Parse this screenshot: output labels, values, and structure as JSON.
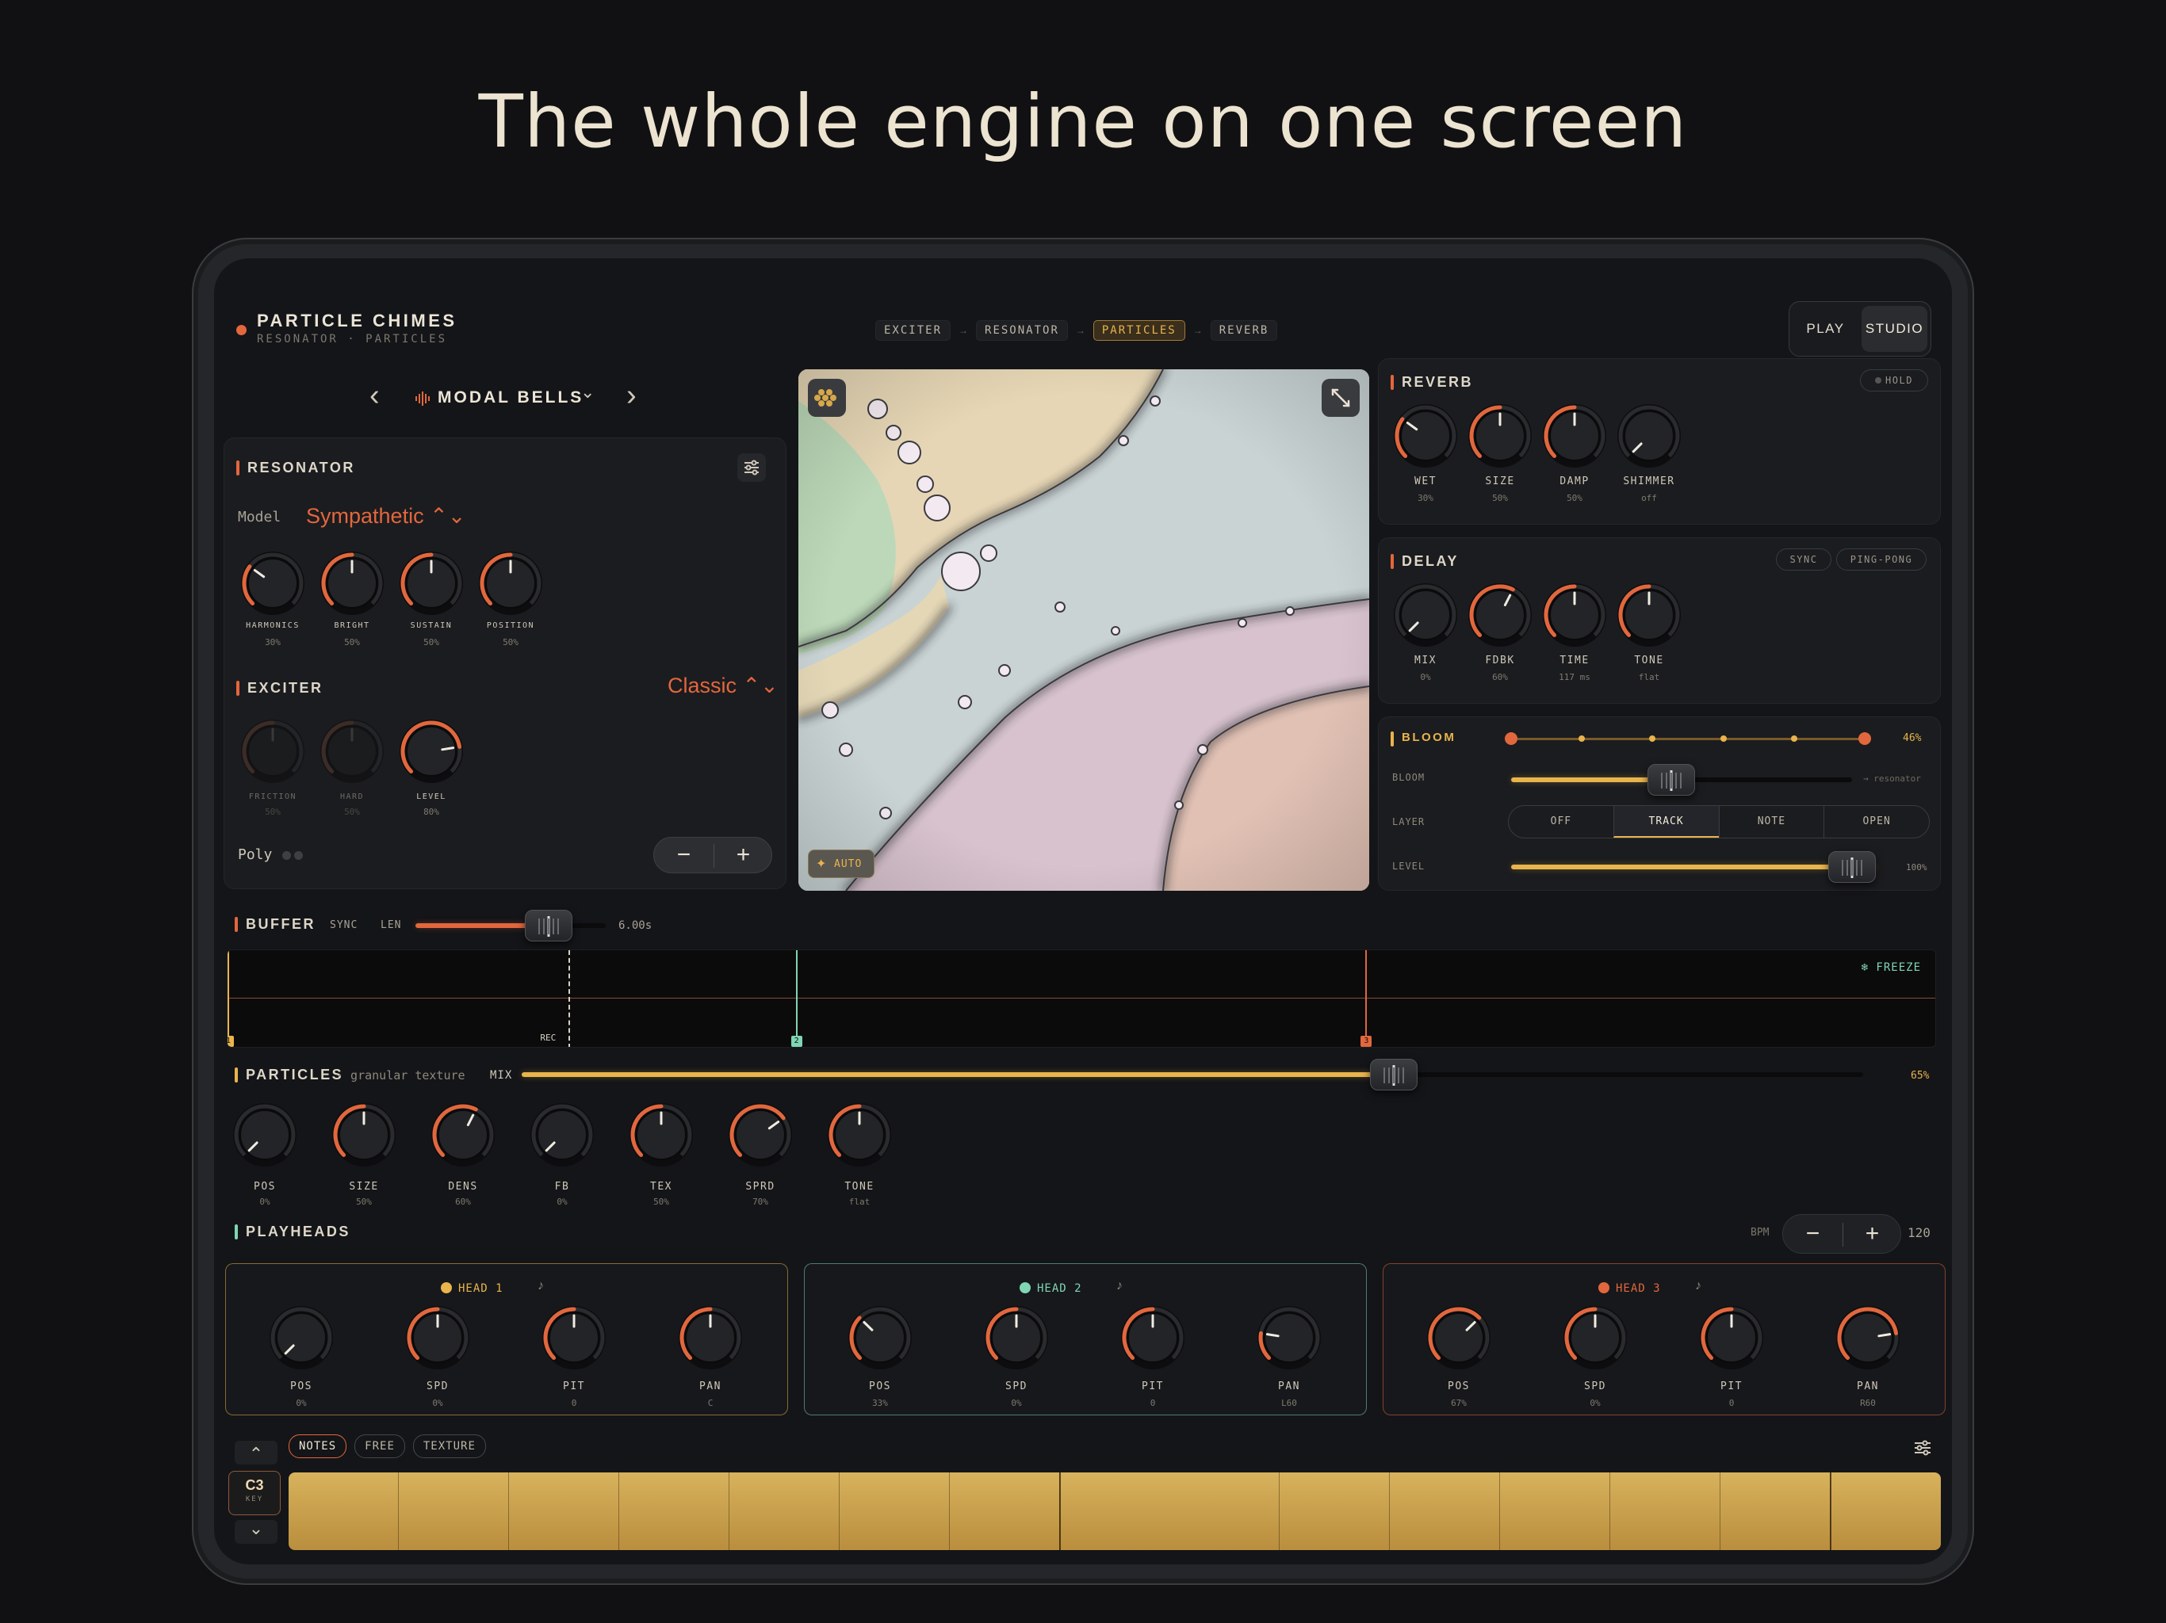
{
  "headline": "The whole engine on one screen",
  "app": {
    "title": "PARTICLE CHIMES",
    "subtitle": "RESONATOR · PARTICLES",
    "status_color": "#e2673d"
  },
  "signal_chain": {
    "items": [
      "EXCITER",
      "RESONATOR",
      "PARTICLES",
      "REVERB"
    ],
    "arrow": "→",
    "active": "PARTICLES"
  },
  "mode_switch": {
    "options": [
      "PLAY",
      "STUDIO"
    ],
    "active": "STUDIO"
  },
  "preset": {
    "name": "MODAL BELLS",
    "prev": "‹",
    "next": "›",
    "caret": "⌄"
  },
  "resonator": {
    "title": "RESONATOR",
    "model_label": "Model",
    "model_value": "Sympathetic ⌃⌄",
    "knobs": [
      {
        "label": "HARMONICS",
        "value": "30%",
        "level": 0.3
      },
      {
        "label": "BRIGHT",
        "value": "50%",
        "level": 0.5
      },
      {
        "label": "SUSTAIN",
        "value": "50%",
        "level": 0.5
      },
      {
        "label": "POSITION",
        "value": "50%",
        "level": 0.5
      }
    ]
  },
  "exciter": {
    "title": "EXCITER",
    "type_value": "Classic ⌃⌄",
    "knobs": [
      {
        "label": "FRICTION",
        "value": "50%",
        "level": 0.5,
        "dim": true
      },
      {
        "label": "HARD",
        "value": "50%",
        "level": 0.5,
        "dim": true
      },
      {
        "label": "LEVEL",
        "value": "80%",
        "level": 0.8,
        "dim": false
      }
    ],
    "poly_label": "Poly",
    "minus": "−",
    "plus": "+"
  },
  "visualizer": {
    "auto_label": "AUTO"
  },
  "reverb": {
    "title": "REVERB",
    "hold_label": "HOLD",
    "knobs": [
      {
        "label": "WET",
        "value": "30%",
        "level": 0.3
      },
      {
        "label": "SIZE",
        "value": "50%",
        "level": 0.5
      },
      {
        "label": "DAMP",
        "value": "50%",
        "level": 0.5
      },
      {
        "label": "SHIMMER",
        "value": "off",
        "level": 0.0
      }
    ]
  },
  "delay": {
    "title": "DELAY",
    "sync_label": "SYNC",
    "pingpong_label": "PING-PONG",
    "knobs": [
      {
        "label": "MIX",
        "value": "0%",
        "level": 0.0
      },
      {
        "label": "FDBK",
        "value": "60%",
        "level": 0.6
      },
      {
        "label": "TIME",
        "value": "117 ms",
        "level": 0.5
      },
      {
        "label": "TONE",
        "value": "flat",
        "level": 0.5
      }
    ]
  },
  "bloom": {
    "title": "BLOOM",
    "amount": "46%",
    "amount_level": 0.46,
    "bloom_label": "BLOOM",
    "bloom_level": 0.47,
    "bloom_target": "→ resonator",
    "layer_label": "LAYER",
    "layer_options": [
      "OFF",
      "TRACK",
      "NOTE",
      "OPEN"
    ],
    "layer_active": "TRACK",
    "level_label": "LEVEL",
    "level_value": "100%",
    "level_level": 1.0
  },
  "buffer": {
    "title": "BUFFER",
    "sync_label": "SYNC",
    "len_label": "LEN",
    "len_value": "6.00s",
    "len_level": 0.7,
    "freeze_label": "❄ FREEZE",
    "rec_label": "REC",
    "markers": [
      {
        "label": "1",
        "pos": 0.0,
        "color": "#e9b44c"
      },
      {
        "label": "2",
        "pos": 0.333,
        "color": "#7fd6b4"
      },
      {
        "label": "3",
        "pos": 0.667,
        "color": "#e2673d"
      }
    ],
    "rec_pos": 0.2
  },
  "particles": {
    "title": "PARTICLES",
    "subtitle": "· granular texture",
    "mix_label": "MIX",
    "mix_value": "65%",
    "mix_level": 0.65,
    "knobs": [
      {
        "label": "POS",
        "value": "0%",
        "level": 0.0
      },
      {
        "label": "SIZE",
        "value": "50%",
        "level": 0.5
      },
      {
        "label": "DENS",
        "value": "60%",
        "level": 0.6
      },
      {
        "label": "FB",
        "value": "0%",
        "level": 0.0
      },
      {
        "label": "TEX",
        "value": "50%",
        "level": 0.5
      },
      {
        "label": "SPRD",
        "value": "70%",
        "level": 0.7
      },
      {
        "label": "TONE",
        "value": "flat",
        "level": 0.5
      }
    ]
  },
  "playheads": {
    "title": "PLAYHEADS",
    "bpm_label": "BPM",
    "bpm_value": "120",
    "minus": "−",
    "plus": "+",
    "note_icon": "♪",
    "heads": [
      {
        "name": "HEAD 1",
        "color": "#e9b44c",
        "knobs": [
          {
            "label": "POS",
            "value": "0%",
            "level": 0.0
          },
          {
            "label": "SPD",
            "value": "0%",
            "level": 0.5
          },
          {
            "label": "PIT",
            "value": "0",
            "level": 0.5
          },
          {
            "label": "PAN",
            "value": "C",
            "level": 0.5
          }
        ]
      },
      {
        "name": "HEAD 2",
        "color": "#7fd6b4",
        "knobs": [
          {
            "label": "POS",
            "value": "33%",
            "level": 0.33
          },
          {
            "label": "SPD",
            "value": "0%",
            "level": 0.5
          },
          {
            "label": "PIT",
            "value": "0",
            "level": 0.5
          },
          {
            "label": "PAN",
            "value": "L60",
            "level": 0.2
          }
        ]
      },
      {
        "name": "HEAD 3",
        "color": "#e2673d",
        "knobs": [
          {
            "label": "POS",
            "value": "67%",
            "level": 0.67
          },
          {
            "label": "SPD",
            "value": "0%",
            "level": 0.5
          },
          {
            "label": "PIT",
            "value": "0",
            "level": 0.5
          },
          {
            "label": "PAN",
            "value": "R60",
            "level": 0.8
          }
        ]
      }
    ]
  },
  "keyboard": {
    "tabs": [
      "NOTES",
      "FREE",
      "TEXTURE"
    ],
    "active_tab": "NOTES",
    "key_value": "C3",
    "key_label": "KEY",
    "up": "⌃",
    "down": "⌄",
    "key_count": 15
  },
  "colors": {
    "accent": "#e2673d",
    "gold": "#e9b44c",
    "teal": "#7fd6b4",
    "bg": "#141518"
  }
}
